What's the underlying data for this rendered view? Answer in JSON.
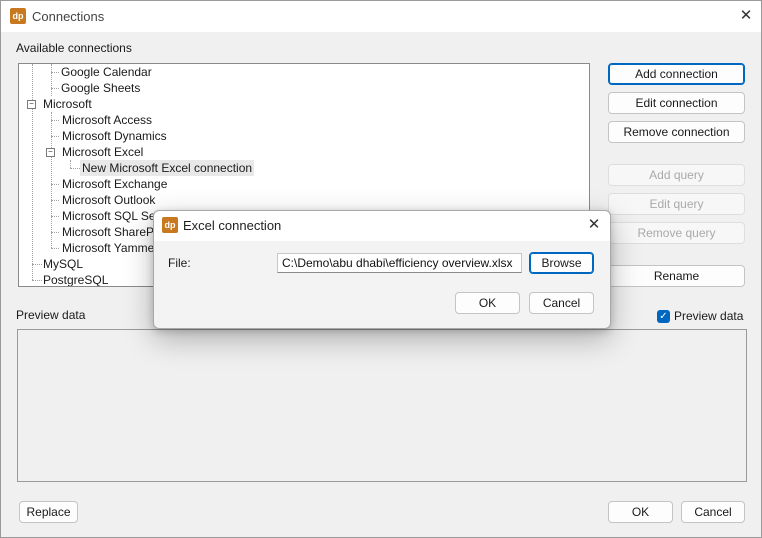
{
  "window": {
    "title": "Connections",
    "app_icon": "dp",
    "close_glyph": "✕"
  },
  "available_connections_label": "Available connections",
  "tree": {
    "items": [
      {
        "label": "Google Calendar"
      },
      {
        "label": "Google Sheets"
      },
      {
        "label": "Microsoft",
        "toggle": "−"
      },
      {
        "label": "Microsoft Access"
      },
      {
        "label": "Microsoft Dynamics"
      },
      {
        "label": "Microsoft Excel",
        "toggle": "−"
      },
      {
        "label": "New Microsoft Excel connection"
      },
      {
        "label": "Microsoft Exchange"
      },
      {
        "label": "Microsoft Outlook"
      },
      {
        "label": "Microsoft SQL Server"
      },
      {
        "label": "Microsoft SharePoint"
      },
      {
        "label": "Microsoft Yammer"
      },
      {
        "label": "MySQL"
      },
      {
        "label": "PostgreSQL"
      }
    ]
  },
  "side_buttons": {
    "add_connection": "Add connection",
    "edit_connection": "Edit connection",
    "remove_connection": "Remove connection",
    "add_query": "Add query",
    "edit_query": "Edit query",
    "remove_query": "Remove query",
    "rename": "Rename"
  },
  "preview": {
    "label": "Preview data",
    "checkbox_label": "Preview data",
    "checkbox_checked": true,
    "check_glyph": "✓"
  },
  "footer": {
    "replace": "Replace",
    "ok": "OK",
    "cancel": "Cancel"
  },
  "dialog": {
    "title": "Excel connection",
    "app_icon": "dp",
    "close_glyph": "✕",
    "file_label": "File:",
    "file_value": "C:\\Demo\\abu dhabi\\efficiency overview.xlsx",
    "browse": "Browse",
    "ok": "OK",
    "cancel": "Cancel"
  },
  "colors": {
    "accent": "#0067c0",
    "app_icon": "#c8791f"
  }
}
